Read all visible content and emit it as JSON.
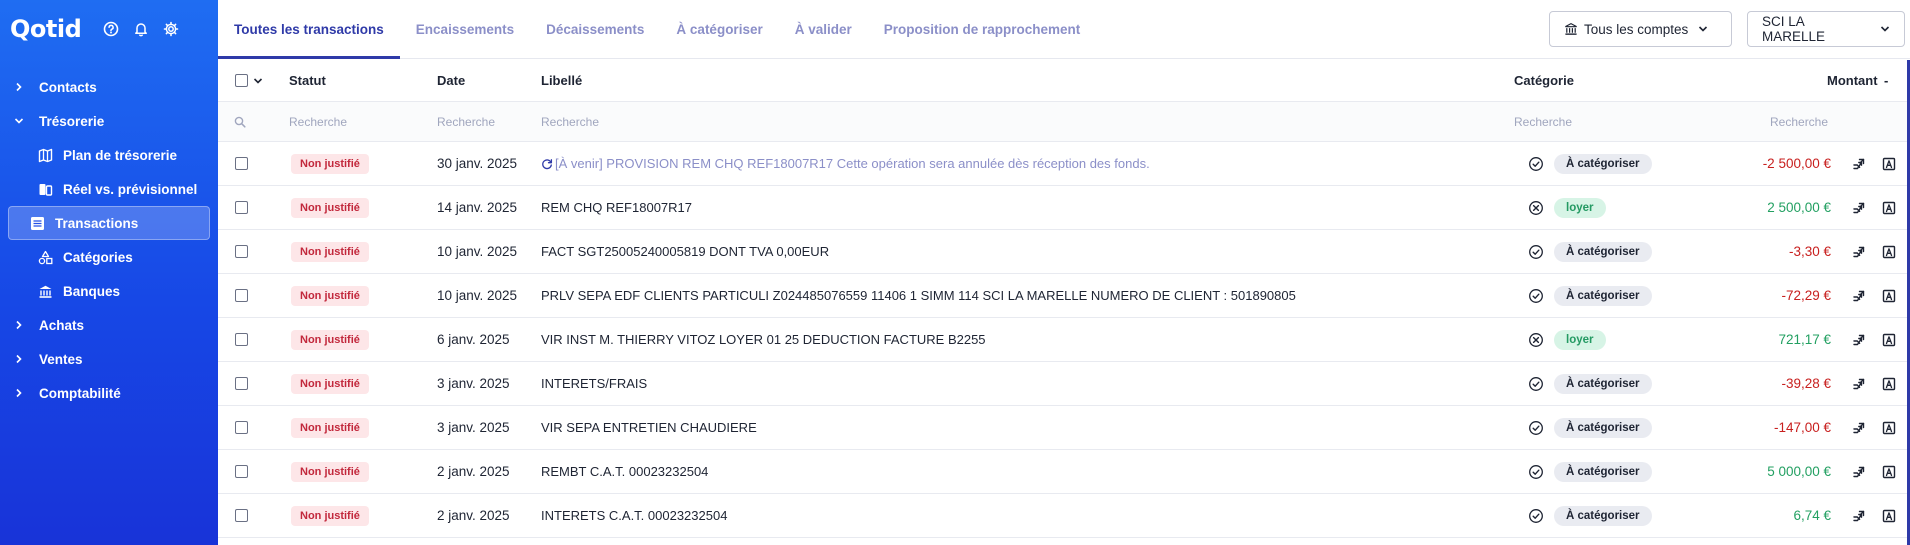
{
  "app": {
    "logo": "Qotid"
  },
  "sidebar": {
    "items": [
      {
        "label": "Contacts",
        "expanded": false
      },
      {
        "label": "Trésorerie",
        "expanded": true
      },
      {
        "label": "Plan de trésorerie"
      },
      {
        "label": "Réel vs. prévisionnel"
      },
      {
        "label": "Transactions",
        "active": true
      },
      {
        "label": "Catégories"
      },
      {
        "label": "Banques"
      },
      {
        "label": "Achats",
        "expanded": false
      },
      {
        "label": "Ventes",
        "expanded": false
      },
      {
        "label": "Comptabilité",
        "expanded": false
      }
    ]
  },
  "tabs": [
    {
      "label": "Toutes les transactions",
      "active": true
    },
    {
      "label": "Encaissements"
    },
    {
      "label": "Décaissements"
    },
    {
      "label": "À catégoriser"
    },
    {
      "label": "À valider"
    },
    {
      "label": "Proposition de rapprochement"
    }
  ],
  "toolbar": {
    "accounts_label": "Tous les comptes",
    "company_label": "SCI LA MARELLE"
  },
  "table": {
    "headers": {
      "status": "Statut",
      "date": "Date",
      "label": "Libellé",
      "category": "Catégorie",
      "amount": "Montant",
      "menu": "-"
    },
    "search_placeholders": {
      "status": "Recherche",
      "date": "Recherche",
      "label": "Recherche",
      "category": "Recherche",
      "amount": "Recherche"
    },
    "rows": [
      {
        "status": "Non justifié",
        "date": "30 janv. 2025",
        "label": "[À venir] PROVISION REM CHQ REF18007R17 Cette opération sera annulée dès réception des fonds.",
        "pending": true,
        "cat_state": "check",
        "category": "À catégoriser",
        "cat_style": "grey",
        "amount": "-2 500,00 €",
        "sign": "neg"
      },
      {
        "status": "Non justifié",
        "date": "14 janv. 2025",
        "label": "REM CHQ REF18007R17",
        "cat_state": "cross",
        "category": "loyer",
        "cat_style": "green",
        "amount": "2 500,00 €",
        "sign": "pos"
      },
      {
        "status": "Non justifié",
        "date": "10 janv. 2025",
        "label": "FACT SGT25005240005819 DONT TVA 0,00EUR",
        "cat_state": "check",
        "category": "À catégoriser",
        "cat_style": "grey",
        "amount": "-3,30 €",
        "sign": "neg"
      },
      {
        "status": "Non justifié",
        "date": "10 janv. 2025",
        "label": "PRLV SEPA EDF CLIENTS PARTICULI Z024485076559 11406 1 SIMM 114 SCI LA MARELLE NUMERO DE CLIENT : 501890805",
        "cat_state": "check",
        "category": "À catégoriser",
        "cat_style": "grey",
        "amount": "-72,29 €",
        "sign": "neg"
      },
      {
        "status": "Non justifié",
        "date": "6 janv. 2025",
        "label": "VIR INST M. THIERRY VITOZ LOYER 01 25 DEDUCTION FACTURE B2255",
        "cat_state": "cross",
        "category": "loyer",
        "cat_style": "green",
        "amount": "721,17 €",
        "sign": "pos"
      },
      {
        "status": "Non justifié",
        "date": "3 janv. 2025",
        "label": "INTERETS/FRAIS",
        "cat_state": "check",
        "category": "À catégoriser",
        "cat_style": "grey",
        "amount": "-39,28 €",
        "sign": "neg"
      },
      {
        "status": "Non justifié",
        "date": "3 janv. 2025",
        "label": "VIR SEPA ENTRETIEN CHAUDIERE",
        "cat_state": "check",
        "category": "À catégoriser",
        "cat_style": "grey",
        "amount": "-147,00 €",
        "sign": "neg"
      },
      {
        "status": "Non justifié",
        "date": "2 janv. 2025",
        "label": "REMBT C.A.T. 00023232504",
        "cat_state": "check",
        "category": "À catégoriser",
        "cat_style": "grey",
        "amount": "5 000,00 €",
        "sign": "pos"
      },
      {
        "status": "Non justifié",
        "date": "2 janv. 2025",
        "label": "INTERETS C.A.T. 00023232504",
        "cat_state": "check",
        "category": "À catégoriser",
        "cat_style": "grey",
        "amount": "6,74 €",
        "sign": "pos"
      }
    ]
  },
  "colors": {
    "sidebar_top": "#1f6df2",
    "sidebar_bottom": "#1833d8",
    "accent": "#2f3aa8",
    "negative": "#c8201f",
    "positive": "#23a062"
  }
}
